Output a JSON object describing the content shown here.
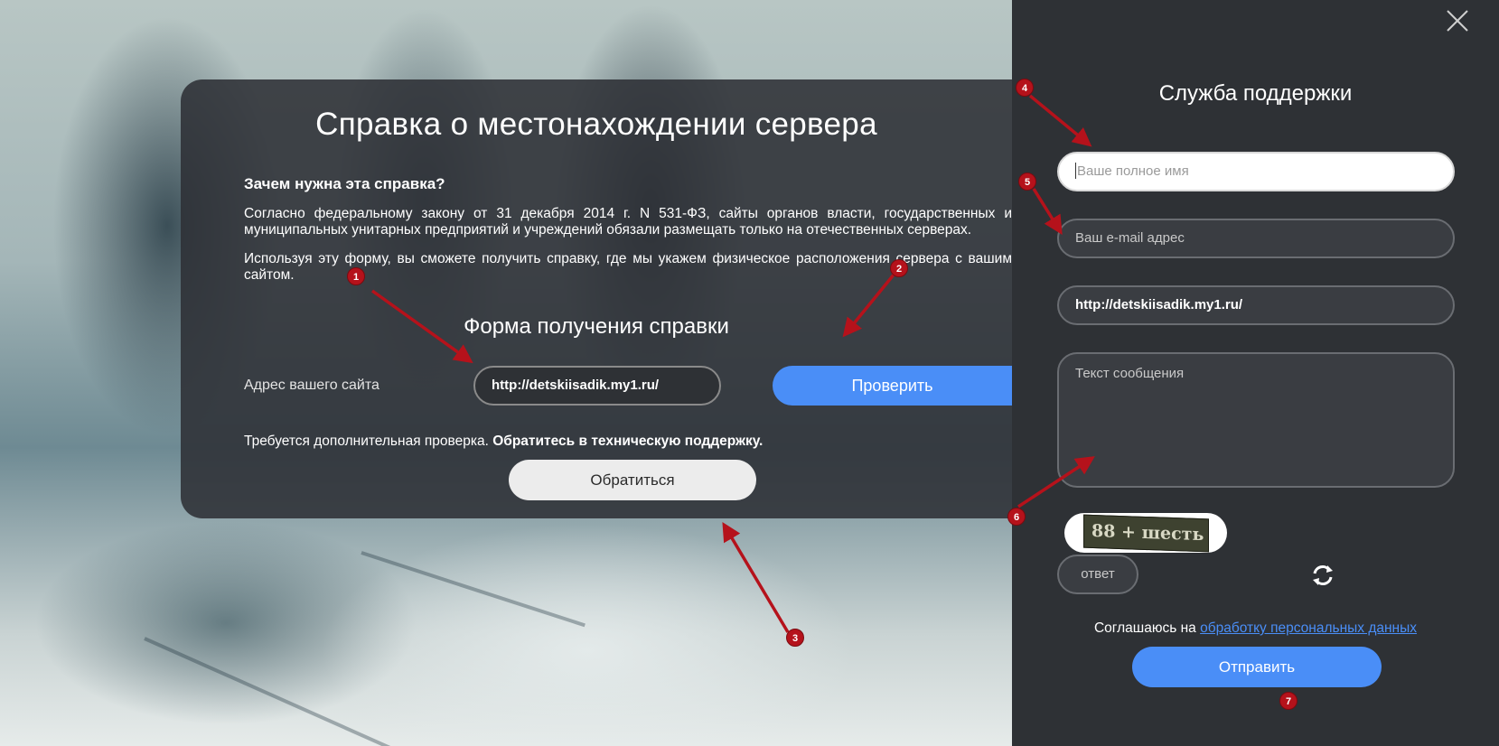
{
  "dialog": {
    "title": "Справка о местонахождении сервера",
    "question": "Зачем нужна эта справка?",
    "paragraph1": "Согласно федеральному закону от 31 декабря 2014 г. N 531-ФЗ, сайты органов власти, государственных и муниципальных унитарных предприятий и учреждений обязали размещать только на отечественных серверах.",
    "paragraph2": "Используя эту форму, вы сможете получить справку, где мы укажем физическое расположения сервера с вашим сайтом.",
    "form_title": "Форма получения справки",
    "site_label": "Адрес вашего сайта",
    "site_value": "http://detskiisadik.my1.ru/",
    "check_label": "Проверить",
    "extra_text": "Требуется дополнительная проверка.",
    "extra_bold": "Обратитесь в техническую поддержку.",
    "contact_label": "Обратиться"
  },
  "support": {
    "title": "Служба поддержки",
    "name_placeholder": "Ваше полное имя",
    "email_placeholder": "Ваш e-mail адрес",
    "site_value": "http://detskiisadik.my1.ru/",
    "message_placeholder": "Текст сообщения",
    "captcha_text": "88 + шесть",
    "answer_placeholder": "ответ",
    "consent_text": "Соглашаюсь на",
    "consent_link": "обработку персональных данных",
    "send_label": "Отправить"
  },
  "annotations": [
    "1",
    "2",
    "3",
    "4",
    "5",
    "6",
    "7"
  ],
  "colors": {
    "accent": "#4a8ef7",
    "panel": "#2e3135",
    "annotation": "#b5121b"
  }
}
